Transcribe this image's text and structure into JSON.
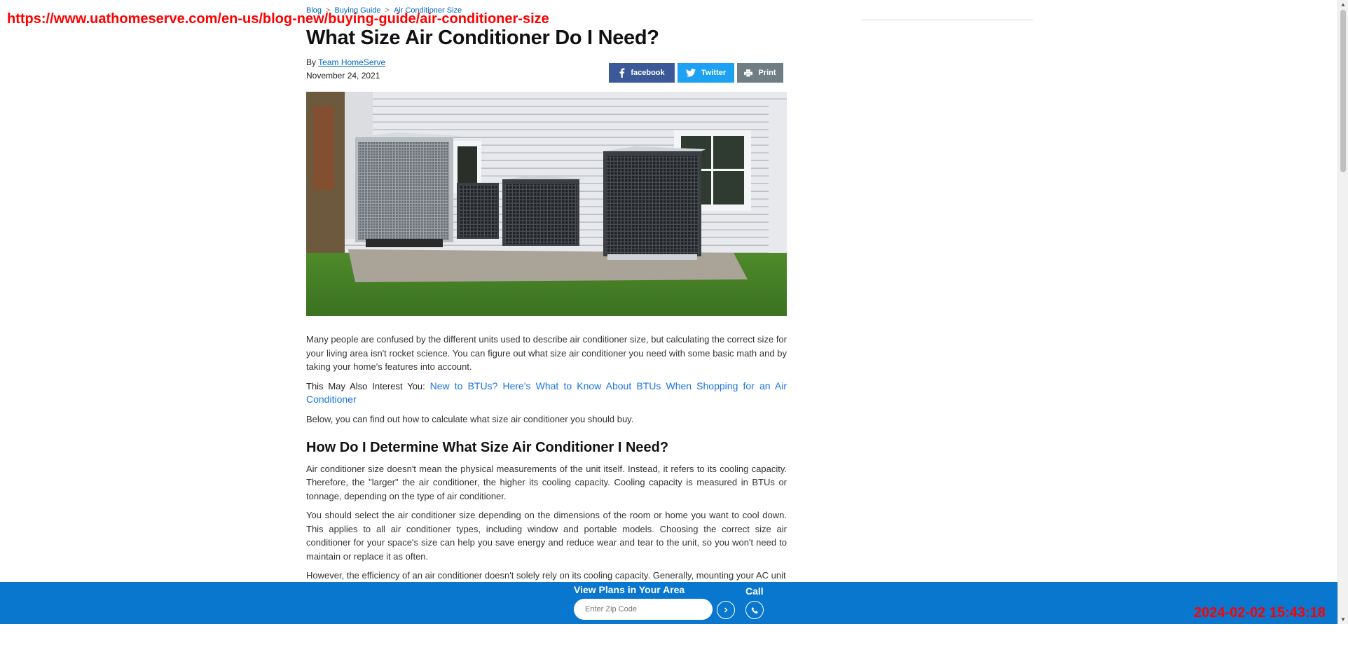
{
  "overlay": {
    "url": "https://www.uathomeserve.com/en-us/blog-new/buying-guide/air-conditioner-size",
    "timestamp": "2024-02-02 15:43:18"
  },
  "breadcrumb": {
    "items": [
      "Blog",
      "Buying Guide",
      "Air Conditioner Size"
    ],
    "separator": ">"
  },
  "article": {
    "title": "What Size Air Conditioner Do I Need?",
    "by_prefix": "By",
    "author": "Team HomeServe",
    "date": "November 24, 2021",
    "share": {
      "facebook": "facebook",
      "twitter": "Twitter",
      "print": "Print"
    },
    "paragraphs": [
      "Many people are confused by the different units used to describe air conditioner size, but calculating the correct size for your living area isn't rocket science. You can figure out what size air conditioner you need with some basic math and by taking your home's features into account.",
      "Below, you can find out how to calculate what size air conditioner you should buy.",
      "Air conditioner size doesn't mean the physical measurements of the unit itself. Instead, it refers to its cooling capacity. Therefore, the \"larger\" the air conditioner, the higher its cooling capacity. Cooling capacity is measured in BTUs or tonnage, depending on the type of air conditioner.",
      "You should select the air conditioner size depending on the dimensions of the room or home you want to cool down. This applies to all air conditioner types, including window and portable models. Choosing the correct size air conditioner for your space's size can help you save energy and reduce wear and tear to the unit, so you won't need to maintain or replace it as often.",
      "However, the efficiency of an air conditioner doesn't solely rely on its cooling capacity. Generally, mounting your AC unit"
    ],
    "interest_label": "This May Also Interest You:",
    "interest_link": "New to BTUs? Here's What to Know About BTUs When Shopping for an Air Conditioner",
    "heading": "How Do I Determine What Size Air Conditioner I Need?"
  },
  "bottom_bar": {
    "plans_title": "View Plans in Your Area",
    "zip_placeholder": "Enter Zip Code",
    "call_label": "Call",
    "bg_color": "#0a77cf"
  },
  "icons": {
    "facebook": "facebook-icon",
    "twitter": "twitter-icon",
    "print": "printer-icon",
    "go": "chevron-right-icon",
    "call": "phone-icon"
  }
}
